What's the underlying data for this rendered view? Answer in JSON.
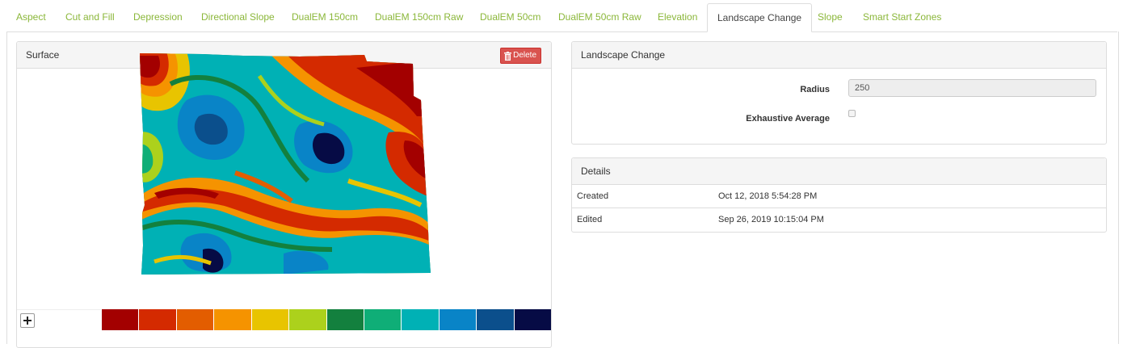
{
  "tabs": [
    {
      "label": "Aspect",
      "active": false
    },
    {
      "label": "Cut and Fill",
      "active": false
    },
    {
      "label": "Depression",
      "active": false
    },
    {
      "label": "Directional Slope",
      "active": false
    },
    {
      "label": "DualEM 150cm",
      "active": false
    },
    {
      "label": "DualEM 150cm Raw",
      "active": false
    },
    {
      "label": "DualEM 50cm",
      "active": false
    },
    {
      "label": "DualEM 50cm Raw",
      "active": false
    },
    {
      "label": "Elevation",
      "active": false
    },
    {
      "label": "Landscape Change",
      "active": true
    },
    {
      "label": "Slope",
      "active": false
    },
    {
      "label": "Smart Start Zones",
      "active": false
    }
  ],
  "surface": {
    "title": "Surface",
    "delete_label": "Delete",
    "legend_colors": [
      "#a30000",
      "#d42a00",
      "#e35d00",
      "#f59300",
      "#e8c400",
      "#acd11c",
      "#13803e",
      "#0fae77",
      "#00b1b5",
      "#0984c7",
      "#0b4f8c",
      "#060b45"
    ]
  },
  "landscape": {
    "title": "Landscape Change",
    "radius_label": "Radius",
    "radius_value": "250",
    "exhaustive_label": "Exhaustive Average",
    "exhaustive_checked": false
  },
  "details": {
    "title": "Details",
    "rows": [
      {
        "label": "Created",
        "value": "Oct 12, 2018 5:54:28 PM"
      },
      {
        "label": "Edited",
        "value": "Sep 26, 2019 10:15:04 PM"
      }
    ]
  }
}
